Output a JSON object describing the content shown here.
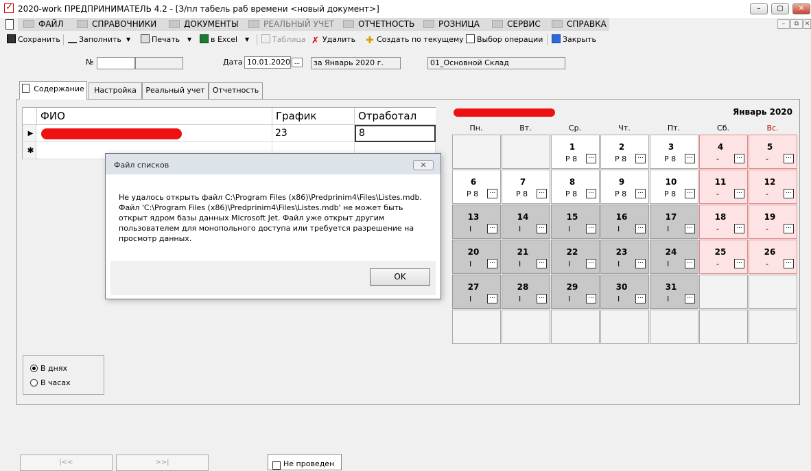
{
  "window": {
    "title": "2020-work  ПРЕДПРИНИМАТЕЛЬ 4.2 - [З/пл табель раб времени <новый документ>]",
    "min_label": "–",
    "max_label": "▢",
    "close_label": "✕"
  },
  "menu": {
    "items": [
      "ФАЙЛ",
      "СПРАВОЧНИКИ",
      "ДОКУМЕНТЫ",
      "РЕАЛЬНЫЙ УЧЕТ",
      "ОТЧЕТНОСТЬ",
      "РОЗНИЦА",
      "СЕРВИС",
      "СПРАВКА"
    ],
    "disabled": [
      false,
      false,
      false,
      true,
      false,
      false,
      false,
      false
    ],
    "mdi_min": "–",
    "mdi_restore": "⧉",
    "mdi_close": "✕"
  },
  "toolbar": {
    "save": "Сохранить",
    "fill": "Заполнить",
    "print": "Печать",
    "excel": "в Excel",
    "table": "Таблица",
    "delete": "Удалить",
    "create_from_current": "Создать по текущему",
    "choose_operation": "Выбор операции",
    "close": "Закрыть",
    "dropdown_arrow": "▼"
  },
  "form": {
    "number_label": "№",
    "number_value": "",
    "date_label": "Дата",
    "date_value": "10.01.2020",
    "date_button": "...",
    "period_value": "за Январь 2020 г.",
    "warehouse_value": "01_Основной Склад"
  },
  "tabs": [
    "Содержание",
    "Настройка",
    "Реальный учет",
    "Отчетность"
  ],
  "grid": {
    "headers": [
      "ФИО",
      "График",
      "Отработал"
    ],
    "rows": [
      {
        "marker": "▶",
        "fio": "",
        "schedule": "23",
        "worked": "8"
      }
    ],
    "new_row_marker": "✱"
  },
  "dialog": {
    "title": "Файл списков",
    "message": "Не удалось открыть файл C:\\Program Files (x86)\\Predprinim4\\Files\\Listes.mdb. Файл 'C:\\Program Files (x86)\\Predprinim4\\Files\\Listes.mdb' не может быть открыт ядром базы данных Microsoft Jet.  Файл уже открыт другим пользователем для монопольного доступа или требуется разрешение на просмотр данных.",
    "ok": "OK",
    "close_icon": "✕"
  },
  "calendar": {
    "employee_name": "",
    "month": "Январь 2020",
    "weekdays": [
      "Пн.",
      "Вт.",
      "Ср.",
      "Чт.",
      "Пт.",
      "Сб.",
      "Вс."
    ],
    "dots": "...",
    "weeks": [
      [
        null,
        null,
        {
          "d": "1",
          "c": "Р 8",
          "t": "work"
        },
        {
          "d": "2",
          "c": "Р 8",
          "t": "work"
        },
        {
          "d": "3",
          "c": "Р 8",
          "t": "work"
        },
        {
          "d": "4",
          "c": "-",
          "t": "weekend"
        },
        {
          "d": "5",
          "c": "-",
          "t": "weekend"
        }
      ],
      [
        {
          "d": "6",
          "c": "Р 8",
          "t": "work"
        },
        {
          "d": "7",
          "c": "Р 8",
          "t": "work"
        },
        {
          "d": "8",
          "c": "Р 8",
          "t": "work"
        },
        {
          "d": "9",
          "c": "Р 8",
          "t": "work"
        },
        {
          "d": "10",
          "c": "Р 8",
          "t": "work"
        },
        {
          "d": "11",
          "c": "-",
          "t": "weekend"
        },
        {
          "d": "12",
          "c": "-",
          "t": "weekend"
        }
      ],
      [
        {
          "d": "13",
          "c": "I",
          "t": "holiday"
        },
        {
          "d": "14",
          "c": "I",
          "t": "holiday"
        },
        {
          "d": "15",
          "c": "I",
          "t": "holiday"
        },
        {
          "d": "16",
          "c": "I",
          "t": "holiday"
        },
        {
          "d": "17",
          "c": "I",
          "t": "holiday"
        },
        {
          "d": "18",
          "c": "-",
          "t": "weekend"
        },
        {
          "d": "19",
          "c": "-",
          "t": "weekend"
        }
      ],
      [
        {
          "d": "20",
          "c": "I",
          "t": "holiday"
        },
        {
          "d": "21",
          "c": "I",
          "t": "holiday"
        },
        {
          "d": "22",
          "c": "I",
          "t": "holiday"
        },
        {
          "d": "23",
          "c": "I",
          "t": "holiday"
        },
        {
          "d": "24",
          "c": "I",
          "t": "holiday"
        },
        {
          "d": "25",
          "c": "-",
          "t": "weekend"
        },
        {
          "d": "26",
          "c": "-",
          "t": "weekend"
        }
      ],
      [
        {
          "d": "27",
          "c": "I",
          "t": "holiday"
        },
        {
          "d": "28",
          "c": "I",
          "t": "holiday"
        },
        {
          "d": "29",
          "c": "I",
          "t": "holiday"
        },
        {
          "d": "30",
          "c": "I",
          "t": "holiday"
        },
        {
          "d": "31",
          "c": "I",
          "t": "holiday"
        },
        null,
        null
      ],
      [
        null,
        null,
        null,
        null,
        null,
        null,
        null
      ]
    ]
  },
  "units": {
    "days": "В днях",
    "hours": "В часах",
    "selected": "days"
  },
  "bottom": {
    "prev": "|<<",
    "next": ">>|",
    "posted": "Не проведен"
  },
  "colors": {
    "weekend_bg": "#fde3e3",
    "holiday_bg": "#c8c8c8",
    "sunday_text": "#c00000"
  }
}
